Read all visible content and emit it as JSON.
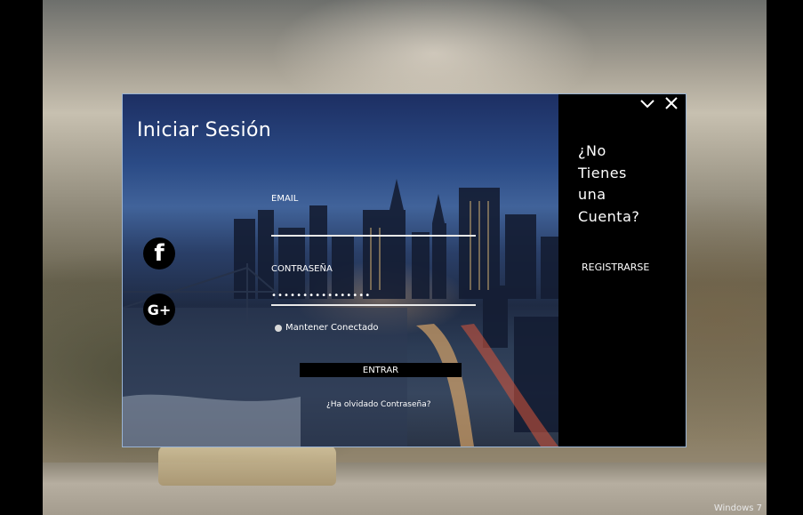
{
  "desktop": {
    "watermark": "Windows 7"
  },
  "login": {
    "title": "Iniciar Sesión",
    "social": {
      "facebook_glyph": "f",
      "google_glyph": "G+"
    },
    "email_label": "EMAIL",
    "email_value": "",
    "password_label": "CONTRASEÑA",
    "password_value": "••••••••••••••••",
    "remember_label": "Mantener Conectado",
    "enter_label": "ENTRAR",
    "forgot_label": "¿Ha olvidado Contraseña?"
  },
  "side": {
    "no_account_lines": [
      "¿No",
      "Tienes",
      "una",
      "Cuenta?"
    ],
    "register_label": "REGISTRARSE"
  },
  "controls": {
    "minimize_glyph": "✓",
    "close_glyph": "✕"
  },
  "colors": {
    "side_panel": "#000000",
    "window_border": "#9ab4d4"
  }
}
